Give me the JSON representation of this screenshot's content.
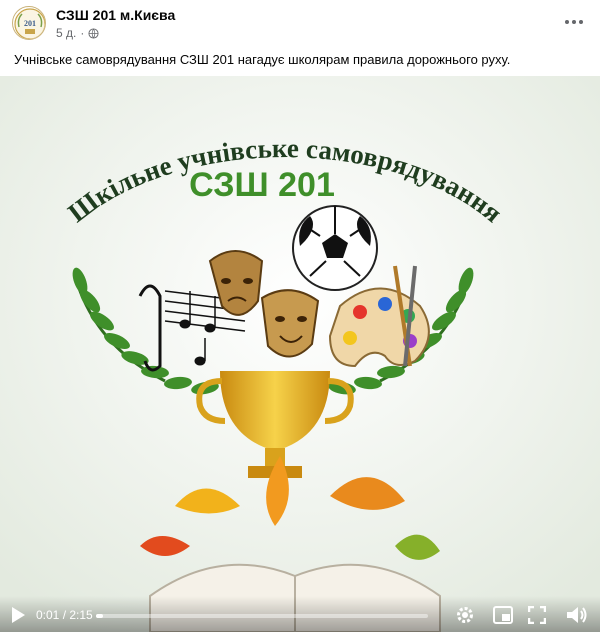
{
  "post": {
    "page_name": "СЗШ 201 м.Києва",
    "timestamp": "5 д.",
    "privacy_icon": "globe-icon",
    "text": "Учнівське самоврядування СЗШ 201 нагадує школярам правила дорожнього руху.",
    "avatar_text": "201"
  },
  "video": {
    "arc_title": "Шкільне учнівське самоврядування",
    "school_label": "СЗШ 201",
    "current_time": "0:01",
    "duration": "2:15",
    "progress_fraction": 0.007
  },
  "icons": {
    "play": "play-icon",
    "volume": "volume-icon",
    "settings": "gear-icon",
    "pip": "picture-in-picture-icon",
    "fullscreen": "fullscreen-icon",
    "more": "more-options-icon"
  },
  "colors": {
    "title_green": "#2f7a2e",
    "arc_text": "#1f3d1f",
    "laurel": "#3f8f2a",
    "cup_gold": "#e7b21c"
  }
}
